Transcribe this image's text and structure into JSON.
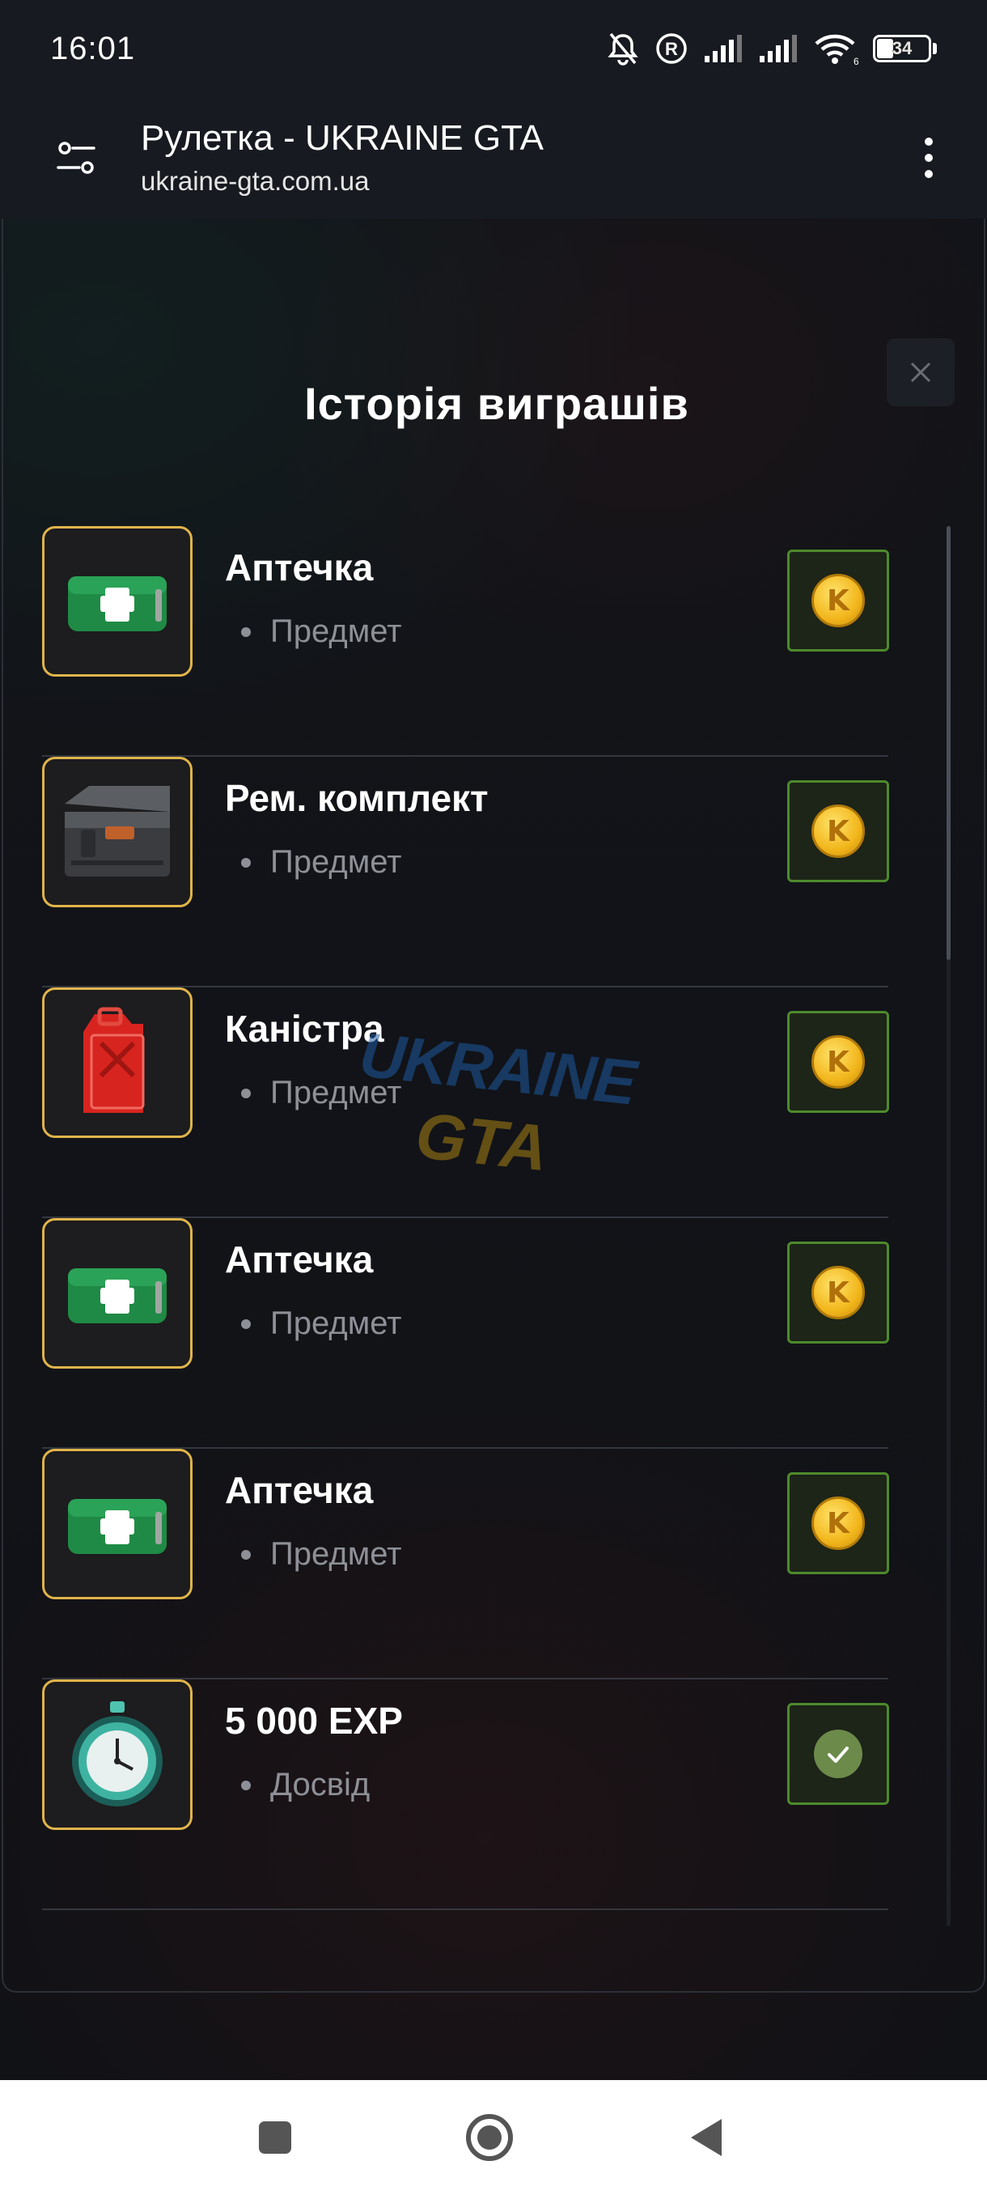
{
  "status_bar": {
    "time": "16:01",
    "battery": "34",
    "wifi_label": "6",
    "icons": [
      "bell-off-icon",
      "registered-icon",
      "signal-icon",
      "signal-icon",
      "wifi-icon",
      "battery-icon"
    ]
  },
  "browser": {
    "title": "Рулетка - UKRAINE GTA",
    "url": "ukraine-gta.com.ua",
    "icons": [
      "tune-icon",
      "more-vert-icon"
    ]
  },
  "modal": {
    "title": "Історія виграшів",
    "close_icon": "close-icon"
  },
  "watermark": {
    "line1": "UKRAINE",
    "line2": "GTA"
  },
  "history": [
    {
      "name": "Аптечка",
      "type": "Предмет",
      "image": "first-aid-kit",
      "status": "coin",
      "coin_letter": "K"
    },
    {
      "name": "Рем. комплект",
      "type": "Предмет",
      "image": "repair-kit",
      "status": "coin",
      "coin_letter": "K"
    },
    {
      "name": "Каністра",
      "type": "Предмет",
      "image": "jerrycan",
      "status": "coin",
      "coin_letter": "K"
    },
    {
      "name": "Аптечка",
      "type": "Предмет",
      "image": "first-aid-kit",
      "status": "coin",
      "coin_letter": "K"
    },
    {
      "name": "Аптечка",
      "type": "Предмет",
      "image": "first-aid-kit",
      "status": "coin",
      "coin_letter": "K"
    },
    {
      "name": "5 000 EXP",
      "type": "Досвід",
      "image": "stopwatch",
      "status": "claimed",
      "coin_letter": ""
    }
  ],
  "colors": {
    "accent_gold": "#e0b44a",
    "status_green": "#4d8a2c",
    "background": "#0f1115"
  },
  "nav": [
    "recent-apps-icon",
    "home-icon",
    "back-icon"
  ]
}
